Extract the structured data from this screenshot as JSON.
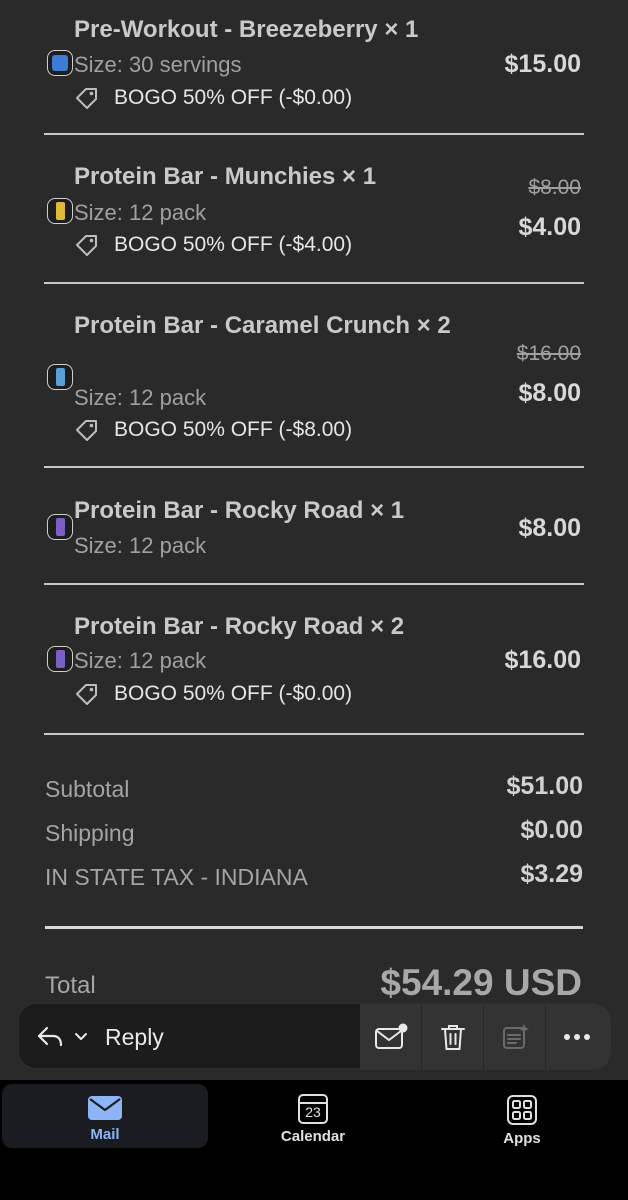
{
  "items": [
    {
      "name": "Pre-Workout - Breezeberry × 1",
      "size": "Size: 30 servings",
      "discount": "BOGO 50% OFF (-$0.00)",
      "price": "$15.00",
      "original_price": null,
      "thumb_icon": "product-jar-icon",
      "thumb_color": "#3e7bd6"
    },
    {
      "name": "Protein Bar - Munchies × 1",
      "size": "Size: 12 pack",
      "discount": "BOGO 50% OFF (-$4.00)",
      "price": "$4.00",
      "original_price": "$8.00",
      "thumb_icon": "product-bar-icon",
      "thumb_color": "#e0b93a"
    },
    {
      "name": "Protein Bar - Caramel Crunch × 2",
      "size": "Size: 12 pack",
      "discount": "BOGO 50% OFF (-$8.00)",
      "price": "$8.00",
      "original_price": "$16.00",
      "thumb_icon": "product-bar-icon",
      "thumb_color": "#5aa0d8"
    },
    {
      "name": "Protein Bar - Rocky Road × 1",
      "size": "Size: 12 pack",
      "discount": null,
      "price": "$8.00",
      "original_price": null,
      "thumb_icon": "product-bar-icon",
      "thumb_color": "#7a5fc4"
    },
    {
      "name": "Protein Bar - Rocky Road × 2",
      "size": "Size: 12 pack",
      "discount": "BOGO 50% OFF (-$0.00)",
      "price": "$16.00",
      "original_price": null,
      "thumb_icon": "product-bar-icon",
      "thumb_color": "#7a5fc4"
    }
  ],
  "summary": {
    "subtotal_label": "Subtotal",
    "subtotal_value": "$51.00",
    "shipping_label": "Shipping",
    "shipping_value": "$0.00",
    "tax_label": "IN STATE TAX - INDIANA",
    "tax_value": "$3.29",
    "total_label": "Total",
    "total_value": "$54.29 USD"
  },
  "reply_bar": {
    "reply_label": "Reply",
    "actions": [
      "mark-unread-icon",
      "trash-icon",
      "summarize-icon",
      "more-icon"
    ]
  },
  "tab_bar": {
    "tabs": [
      {
        "label": "Mail",
        "icon": "mail-icon",
        "active": true
      },
      {
        "label": "Calendar",
        "icon": "calendar-icon",
        "calendar_day": "23",
        "active": false
      },
      {
        "label": "Apps",
        "icon": "apps-icon",
        "active": false
      }
    ]
  },
  "colors": {
    "background": "#2a2a2a",
    "accent": "#8db4f5"
  }
}
